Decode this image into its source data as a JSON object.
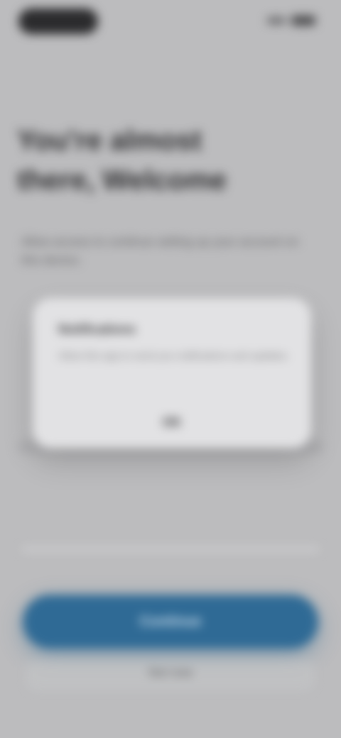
{
  "status_bar": {
    "time": "",
    "signal_icon": "signal-icon",
    "battery_icon": "battery-icon"
  },
  "screen": {
    "headline": "You're almost there, Welcome",
    "subtext": "Allow access to continue setting up your account on this device."
  },
  "dialog": {
    "title": "Notifications",
    "body": "Allow this app to send you notifications and updates.",
    "button_label": "OK"
  },
  "actions": {
    "primary_label": "Continue",
    "secondary_label": "Not now"
  },
  "colors": {
    "background": "#bcbcbe",
    "primary": "#2f6a95",
    "dialog": "#e2e2e4"
  }
}
